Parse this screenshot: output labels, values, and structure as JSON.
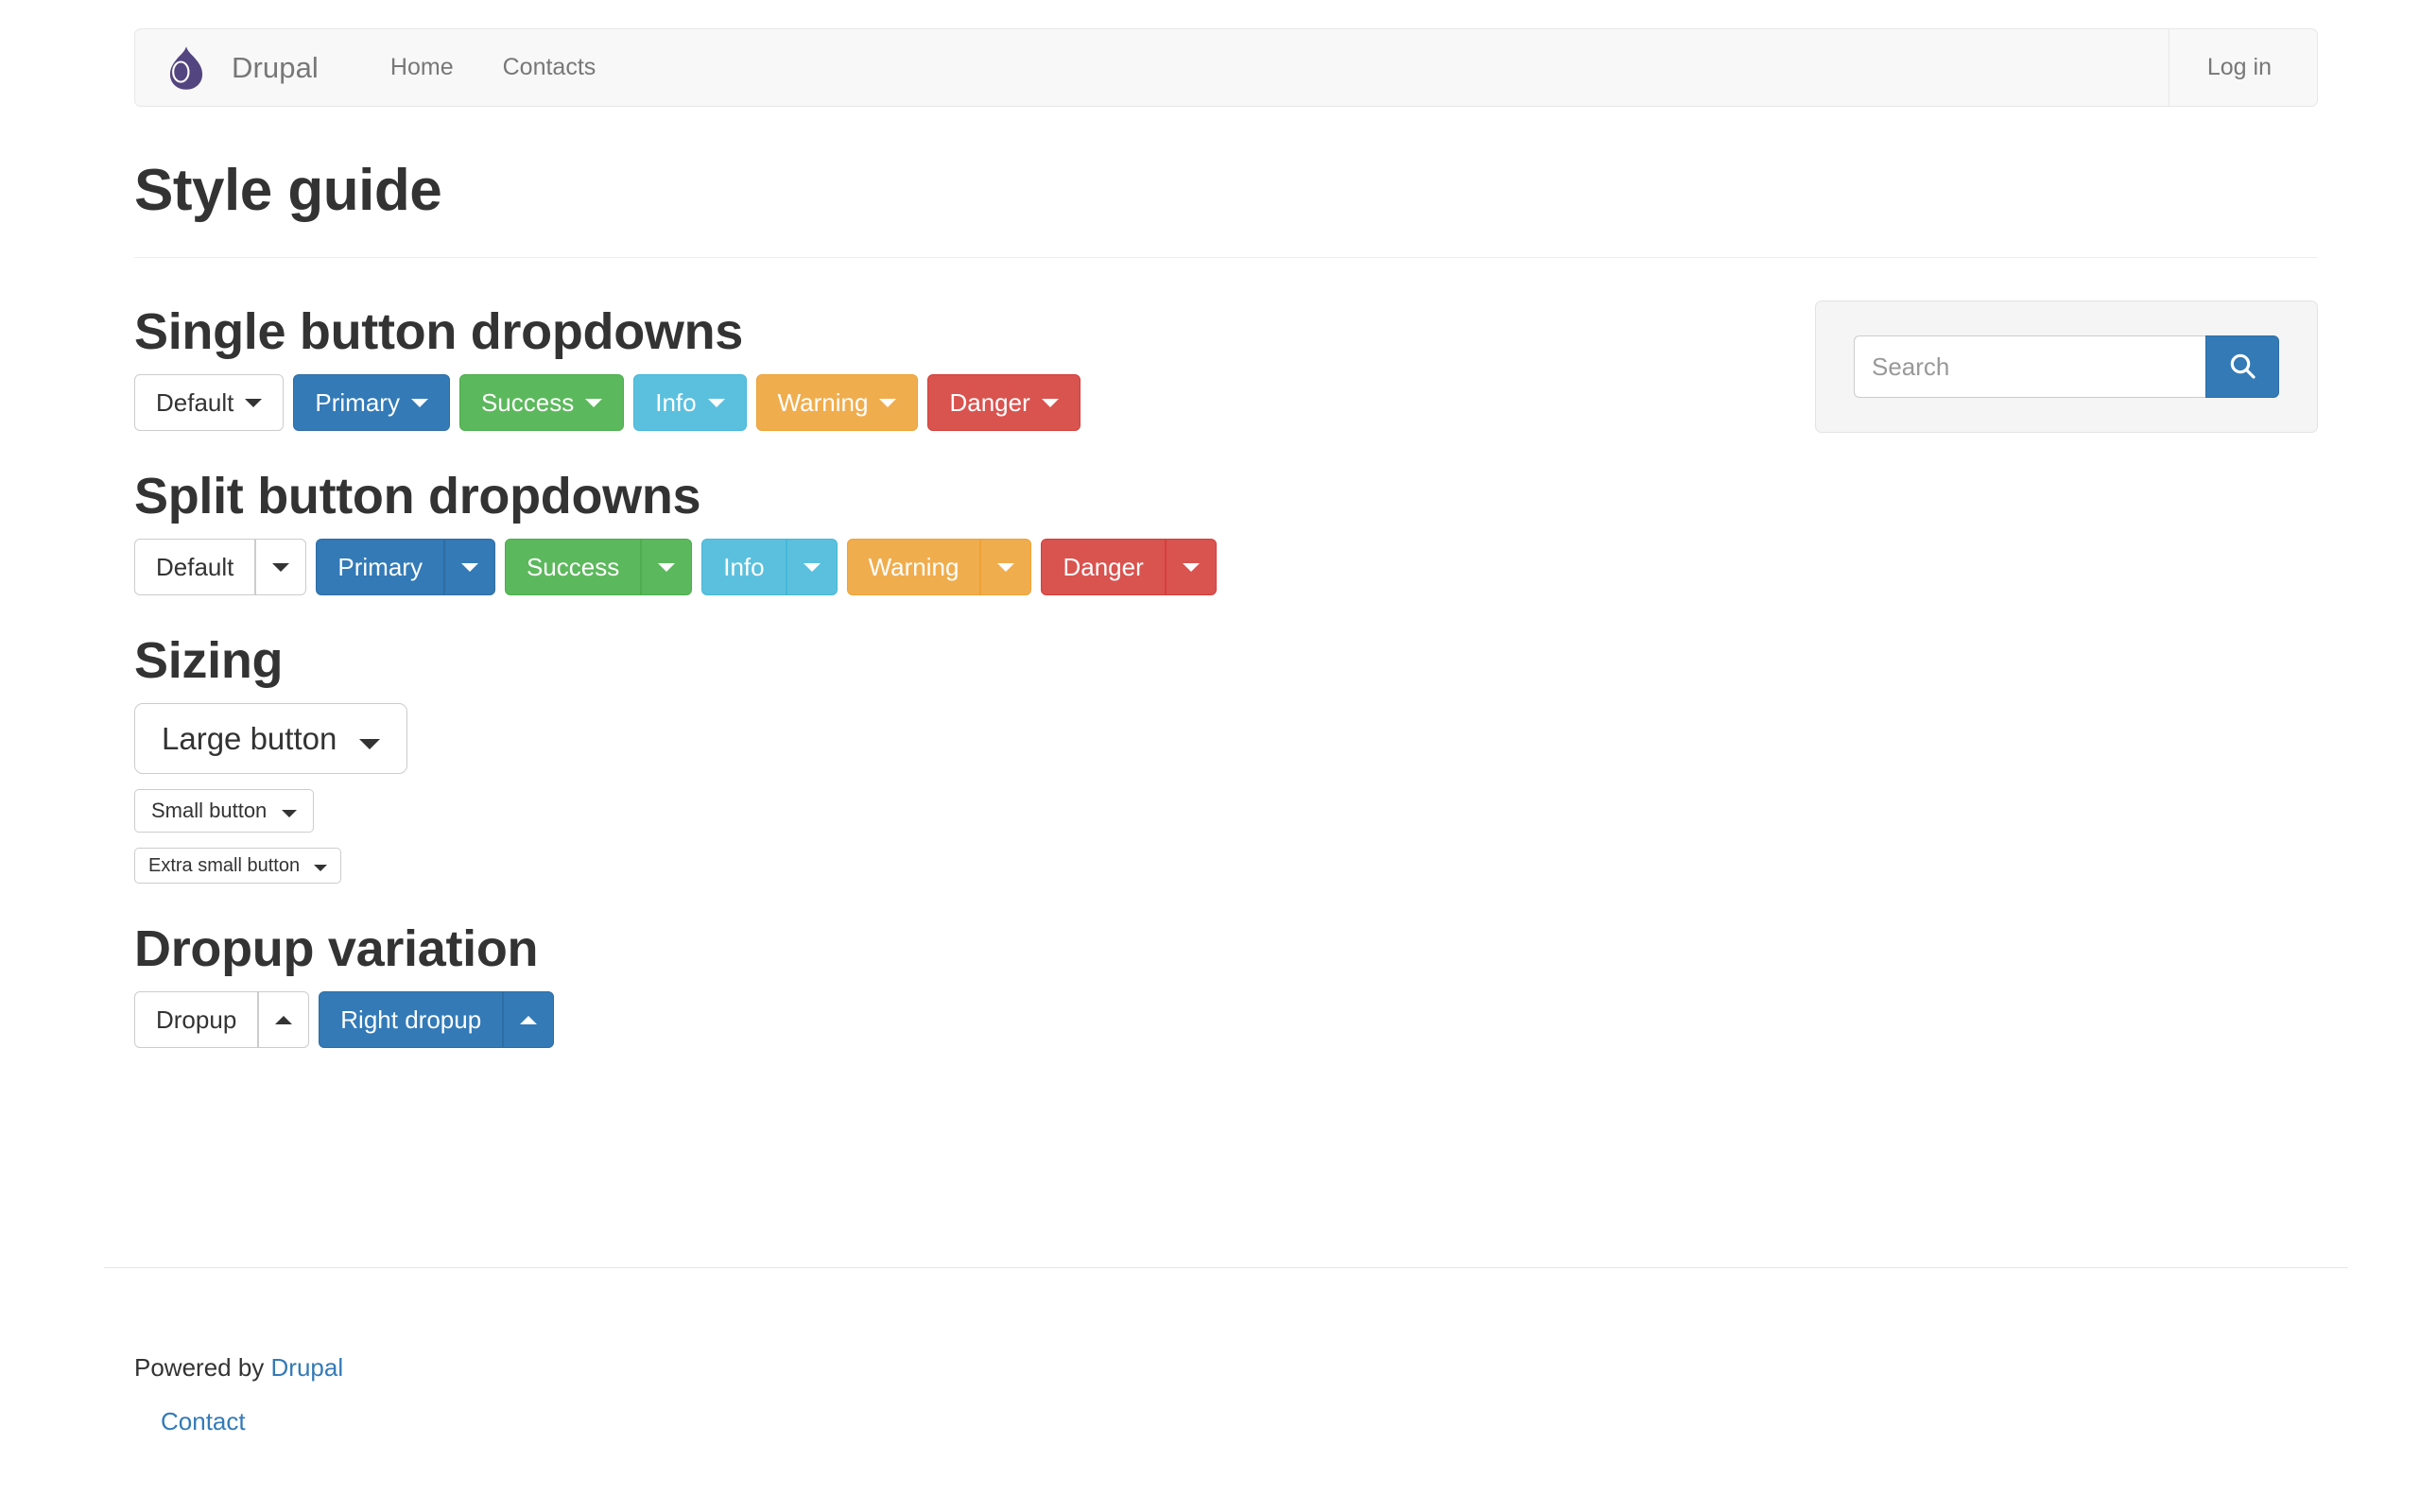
{
  "navbar": {
    "brand_label": "Drupal",
    "logo_icon": "drupal-droplet-icon",
    "logo_color": "#53457f",
    "links": [
      {
        "label": "Home"
      },
      {
        "label": "Contacts"
      }
    ],
    "login_label": "Log in"
  },
  "page": {
    "title": "Style guide"
  },
  "sections": {
    "single": {
      "heading": "Single button dropdowns",
      "buttons": [
        {
          "label": "Default",
          "variant": "default"
        },
        {
          "label": "Primary",
          "variant": "primary"
        },
        {
          "label": "Success",
          "variant": "success"
        },
        {
          "label": "Info",
          "variant": "info"
        },
        {
          "label": "Warning",
          "variant": "warning"
        },
        {
          "label": "Danger",
          "variant": "danger"
        }
      ]
    },
    "split": {
      "heading": "Split button dropdowns",
      "buttons": [
        {
          "label": "Default",
          "variant": "default"
        },
        {
          "label": "Primary",
          "variant": "primary"
        },
        {
          "label": "Success",
          "variant": "success"
        },
        {
          "label": "Info",
          "variant": "info"
        },
        {
          "label": "Warning",
          "variant": "warning"
        },
        {
          "label": "Danger",
          "variant": "danger"
        }
      ]
    },
    "sizing": {
      "heading": "Sizing",
      "buttons": [
        {
          "label": "Large button",
          "size": "lg"
        },
        {
          "label": "Small button",
          "size": "sm"
        },
        {
          "label": "Extra small button",
          "size": "xs"
        }
      ]
    },
    "dropup": {
      "heading": "Dropup variation",
      "buttons": [
        {
          "label": "Dropup",
          "variant": "default"
        },
        {
          "label": "Right dropup",
          "variant": "primary"
        }
      ]
    }
  },
  "sidebar": {
    "search_placeholder": "Search",
    "search_value": "",
    "search_icon": "magnifier-icon"
  },
  "footer": {
    "powered_prefix": "Powered by ",
    "powered_link": "Drupal",
    "contact_link": "Contact"
  },
  "colors": {
    "primary": "#337ab7",
    "success": "#5cb85c",
    "info": "#5bc0de",
    "warning": "#f0ad4e",
    "danger": "#d9534f",
    "default_border": "#cccccc",
    "brand_purple": "#53457f",
    "link": "#337ab7"
  }
}
